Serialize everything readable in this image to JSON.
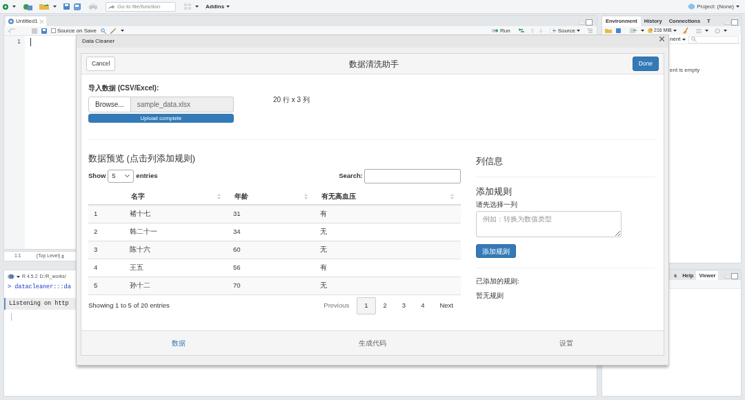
{
  "toolbar": {
    "goto_placeholder": "Go to file/function",
    "addins": "Addins",
    "project": "Project: (None)"
  },
  "editor": {
    "tab": "Untitled1",
    "source_on_save": {
      "label": "Source on Save",
      "checked": false
    },
    "line_number": "1",
    "run": "Run",
    "source": "Source",
    "position": "1:1",
    "scope": "(Top Level)"
  },
  "console": {
    "version": "R 4.5.2",
    "path": "D:/R_works/",
    "lines": [
      {
        "kind": "command",
        "text": "> datacleaner:::da"
      },
      {
        "kind": "message",
        "text": "Listening on http"
      }
    ]
  },
  "environment_pane": {
    "tabs": [
      {
        "label": "Environment",
        "selected": true
      },
      {
        "label": "History",
        "selected": false
      },
      {
        "label": "Connections",
        "selected": false
      },
      {
        "label": "T",
        "selected": false
      }
    ],
    "memory": "216 MiB",
    "scope": "nent",
    "message": "ent is empty"
  },
  "viewer_pane": {
    "tabs": [
      {
        "label": "s",
        "selected": false
      },
      {
        "label": "Help",
        "selected": false
      },
      {
        "label": "Viewer",
        "selected": true
      }
    ]
  },
  "dialog": {
    "title": "Data Cleaner",
    "app_title": "数据清洗助手",
    "cancel": "Cancel",
    "done": "Done",
    "import_label": "导入数据 (CSV/Excel):",
    "browse": "Browse...",
    "filename": "sample_data.xlsx",
    "upload": {
      "label": "Upload complete",
      "level": 1
    },
    "dimensions": "20 行 x 3 列",
    "preview_title": "数据预览 (点击列添加规则)",
    "show_label": "Show",
    "page_length": "5",
    "entries_label": "entries",
    "search_label": "Search:",
    "columns": [
      "",
      "名字",
      "年龄",
      "有无高血压"
    ],
    "rows": [
      [
        "1",
        "褚十七",
        "31",
        "有"
      ],
      [
        "2",
        "韩二十一",
        "34",
        "无"
      ],
      [
        "3",
        "陈十六",
        "60",
        "无"
      ],
      [
        "4",
        "王五",
        "56",
        "有"
      ],
      [
        "5",
        "孙十二",
        "70",
        "无"
      ]
    ],
    "info": "Showing 1 to 5 of 20 entries",
    "pagination": [
      {
        "label": "Previous",
        "selected": false,
        "disabled": true
      },
      {
        "label": "1",
        "selected": true,
        "disabled": false
      },
      {
        "label": "2",
        "selected": false,
        "disabled": false
      },
      {
        "label": "3",
        "selected": false,
        "disabled": false
      },
      {
        "label": "4",
        "selected": false,
        "disabled": false
      },
      {
        "label": "Next",
        "selected": false,
        "disabled": false
      }
    ],
    "column_info_title": "列信息",
    "add_rule_title": "添加规则",
    "select_prompt": "请先选择一列",
    "rule_placeholder": "例如：转换为数值类型",
    "add_rule_button": "添加规则",
    "added_rules_title": "已添加的规则:",
    "no_rules": "暂无规则",
    "footer_tabs": [
      {
        "label": "数据",
        "selected": true
      },
      {
        "label": "生成代码",
        "selected": false
      },
      {
        "label": "设置",
        "selected": false
      }
    ]
  }
}
